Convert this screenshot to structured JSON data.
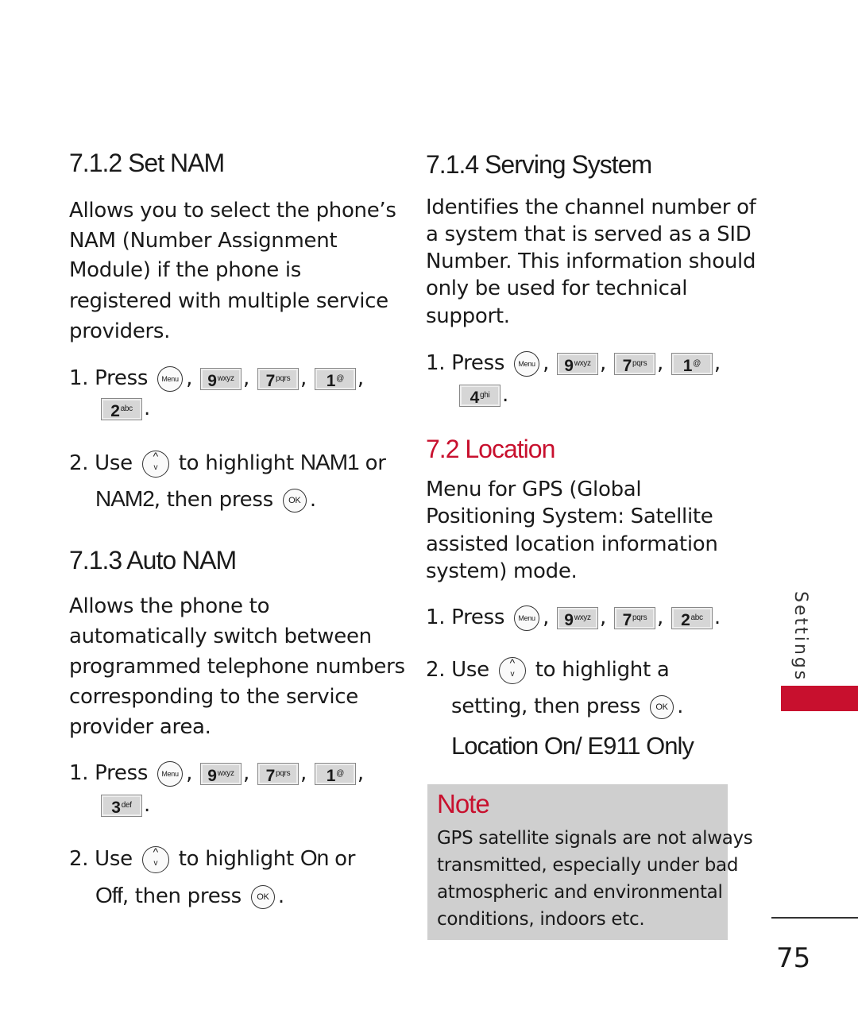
{
  "left": {
    "s712": {
      "title": "7.1.2 Set NAM",
      "body": [
        "Allows you to select the phone’s",
        "NAM (Number Assignment",
        "Module) if the phone is",
        "registered with multiple service",
        "providers."
      ],
      "step1": "1. Press",
      "step2a": "2. Use",
      "step2b": "to highlight",
      "step2c": "NAM1",
      "step2d": "or",
      "step2e": "NAM2",
      "step2f": ", then press"
    },
    "s713": {
      "title": "7.1.3 Auto NAM",
      "body": [
        "Allows the phone to",
        "automatically switch between",
        "programmed telephone numbers",
        "corresponding to the service",
        "provider area."
      ],
      "step1": "1. Press",
      "step2a": "2. Use",
      "step2b": "to highlight",
      "step2c": "On",
      "step2d": "or",
      "step2e": "Off",
      "step2f": ", then press"
    }
  },
  "right": {
    "s714": {
      "title": "7.1.4 Serving System",
      "body": [
        "Identifies the channel number of",
        "a system that is served as a SID",
        "Number. This information should",
        "only be used for technical",
        "support."
      ],
      "step1": "1. Press"
    },
    "s72": {
      "title": "7.2 Location",
      "body": [
        "Menu for GPS (Global",
        "Positioning System: Satellite",
        "assisted location information",
        "system) mode."
      ],
      "step1": "1. Press",
      "step2a": "2. Use",
      "step2b": "to highlight a",
      "step2c": "setting, then press",
      "options": "Location On/ E911 Only"
    },
    "note": {
      "title": "Note",
      "body": [
        "GPS satellite signals are not always",
        "transmitted, especially under bad",
        "atmospheric and environmental",
        "conditions, indoors etc."
      ]
    }
  },
  "keys": {
    "menu": "Menu",
    "ok": "OK",
    "k9": [
      "9",
      "wxyz"
    ],
    "k7": [
      "7",
      "pqrs"
    ],
    "k1": [
      "1",
      "@"
    ],
    "k2": [
      "2",
      "abc"
    ],
    "k3": [
      "3",
      "def"
    ],
    "k4": [
      "4",
      "ghi"
    ]
  },
  "punct": {
    "comma": ",",
    "period": "."
  },
  "sidebar": {
    "tab": "Settings"
  },
  "page_number": "75",
  "colors": {
    "accent": "#c8102e",
    "note_bg": "#cfcfcf"
  }
}
